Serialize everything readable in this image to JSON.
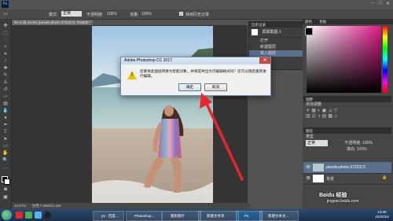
{
  "app": {
    "doc_tab": "Nn-1 @ 44.6% (pexels-photo-3722373, RGB/8) *"
  },
  "options_bar": {
    "mode_label": "模式:",
    "mode_value": "正常",
    "opacity_label": "不透明度:",
    "opacity_value": "100%",
    "flow_label": "流量:",
    "flow_value": "100%",
    "erase_history": "抹到历史记录"
  },
  "status": {
    "zoom": "44.57%",
    "doc_size": "文档:7.03M/21.1M"
  },
  "history_panel": {
    "title": "历史记录",
    "items": [
      "打开",
      "新建图层",
      "载入图层"
    ],
    "top_item": "屏幕截图-1"
  },
  "right_panels": {
    "color_title": "颜色",
    "swatch_title": "色板",
    "adjust_title": "调整",
    "adjust_sub": "添加调整",
    "layers_title": "图层",
    "layer_kind": "类型",
    "blend_mode": "正常",
    "opacity_label": "不透明度:",
    "opacity_value": "100%",
    "fill_label": "填充:",
    "fill_value": "100%",
    "layers": [
      {
        "name": "pexels-photo-3722373"
      },
      {
        "name": "背景"
      }
    ]
  },
  "dialog": {
    "title": "Adobe Photoshop CC 2017",
    "message": "您要将此图层转换为智能对象，并将其导出为可编辑格式吗？您可以稍后重新进行编辑。",
    "ok": "确定",
    "cancel": "取消"
  },
  "taskbar": {
    "tasks": [
      "ps - 百度...",
      "Photoshop...",
      "图形图片",
      "新建文件夹",
      "Ps",
      "新建文本文..."
    ],
    "time": "13:46",
    "date": "2020/4/4"
  },
  "watermark": {
    "line1": "Baidu 经验",
    "line2": "jingyan.baidu.com"
  },
  "colors": {
    "accent_red": "#e8262f",
    "dialog_border": "#6a8fb5"
  }
}
